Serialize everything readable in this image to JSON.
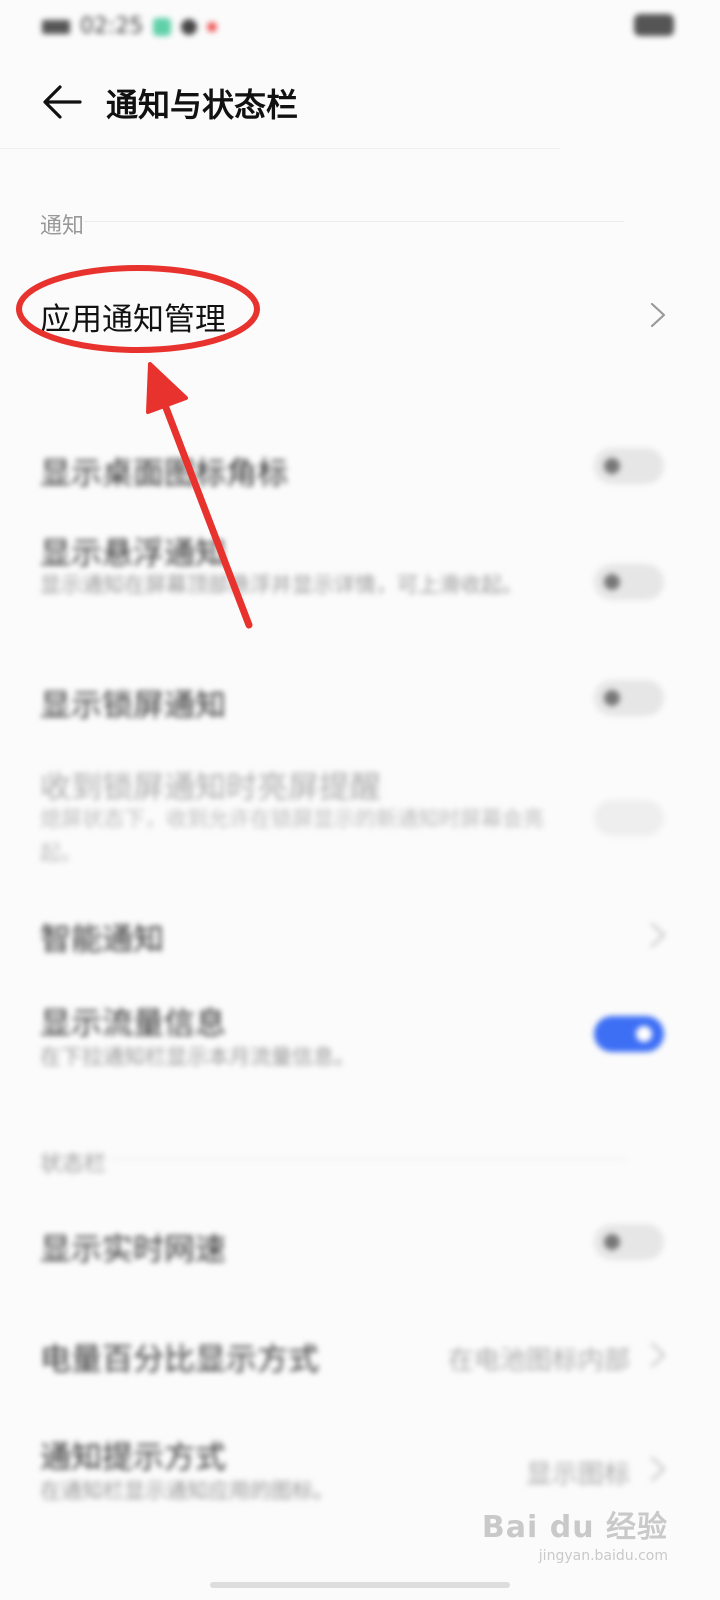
{
  "status_bar": {
    "time": "02:25"
  },
  "header": {
    "title": "通知与状态栏"
  },
  "sections": {
    "notifications": "通知",
    "status_bar": "状态栏"
  },
  "rows": {
    "app_notification_management": "应用通知管理",
    "badge": "显示桌面图标角标",
    "floating": {
      "title": "显示悬浮通知",
      "subtitle": "显示通知在屏幕顶部悬浮并显示详情，可上滑收起。"
    },
    "lock_screen": "显示锁屏通知",
    "wake_screen": {
      "title": "收到锁屏通知时亮屏提醒",
      "subtitle": "熄屏状态下，收到允许在锁屏显示的新通知时屏幕会亮起。"
    },
    "smart": "智能通知",
    "data_usage": {
      "title": "显示流量信息",
      "subtitle": "在下拉通知栏显示本月流量信息。"
    },
    "net_speed": "显示实时网速",
    "battery_percent": {
      "title": "电量百分比显示方式",
      "value": "在电池图标内部"
    },
    "notification_style": {
      "title": "通知提示方式",
      "subtitle": "在通知栏显示通知应用的图标。",
      "value": "显示图标"
    }
  },
  "toggles": {
    "badge": false,
    "floating": false,
    "lock_screen": false,
    "wake_screen": false,
    "data_usage": true,
    "net_speed": false
  },
  "watermark": {
    "brand": "Bai du 经验",
    "url": "jingyan.baidu.com"
  },
  "colors": {
    "accent": "#3d6ff5",
    "annotation": "#e8322d"
  }
}
